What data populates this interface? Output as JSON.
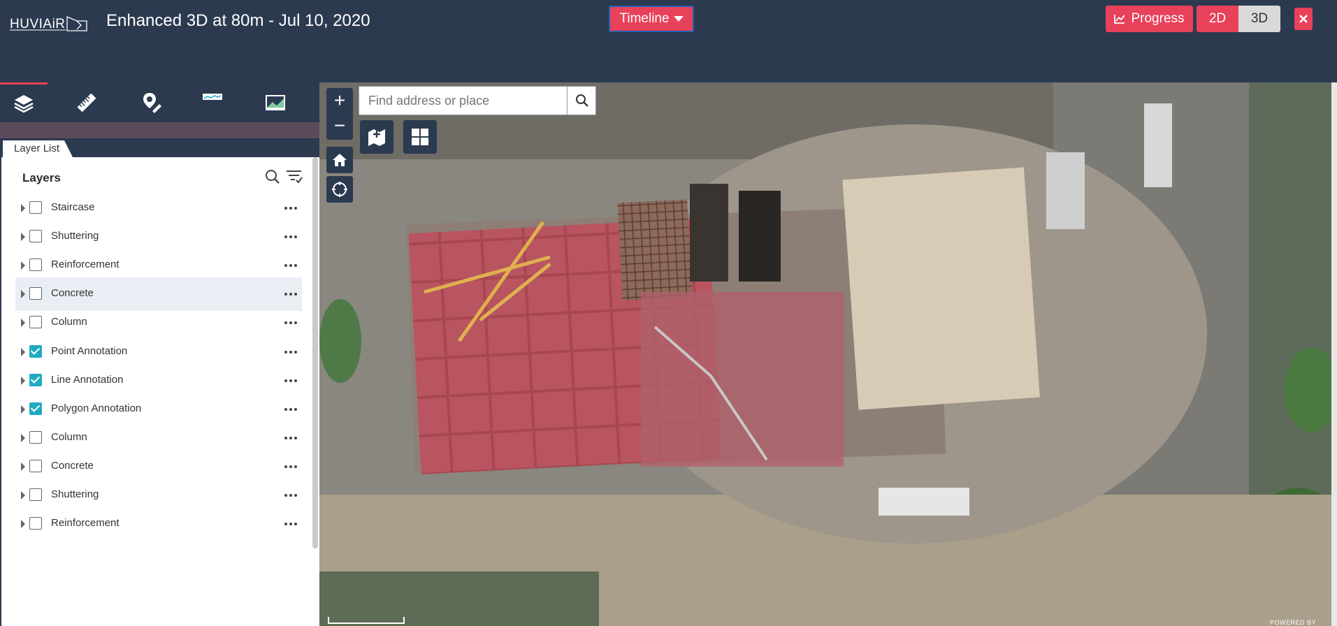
{
  "header": {
    "logo_text": "HUVIAiR",
    "title": "Enhanced 3D at 80m - Jul 10, 2020",
    "timeline_label": "Timeline",
    "progress_label": "Progress",
    "view_2d_label": "2D",
    "view_3d_label": "3D",
    "active_view": "2D",
    "accent_color": "#e8415a",
    "header_color": "#2c3a50"
  },
  "toolbar": {
    "tools": [
      {
        "icon": "layers-icon"
      },
      {
        "icon": "ruler-icon"
      },
      {
        "icon": "marker-icon"
      },
      {
        "icon": "elevation-profile-icon"
      },
      {
        "icon": "image-icon"
      }
    ]
  },
  "panel": {
    "tab_label": "Layer List",
    "heading": "Layers",
    "layers": [
      {
        "label": "Staircase",
        "checked": false
      },
      {
        "label": "Shuttering",
        "checked": false
      },
      {
        "label": "Reinforcement",
        "checked": false
      },
      {
        "label": "Concrete",
        "checked": false
      },
      {
        "label": "Column",
        "checked": false
      },
      {
        "label": "Point Annotation",
        "checked": true
      },
      {
        "label": "Line Annotation",
        "checked": true
      },
      {
        "label": "Polygon Annotation",
        "checked": true
      },
      {
        "label": "Column",
        "checked": false
      },
      {
        "label": "Concrete",
        "checked": false
      },
      {
        "label": "Shuttering",
        "checked": false
      },
      {
        "label": "Reinforcement",
        "checked": false
      }
    ]
  },
  "map": {
    "search_placeholder": "Find address or place",
    "zoom_in_label": "+",
    "zoom_out_label": "−",
    "powered_by": "POWERED BY"
  }
}
